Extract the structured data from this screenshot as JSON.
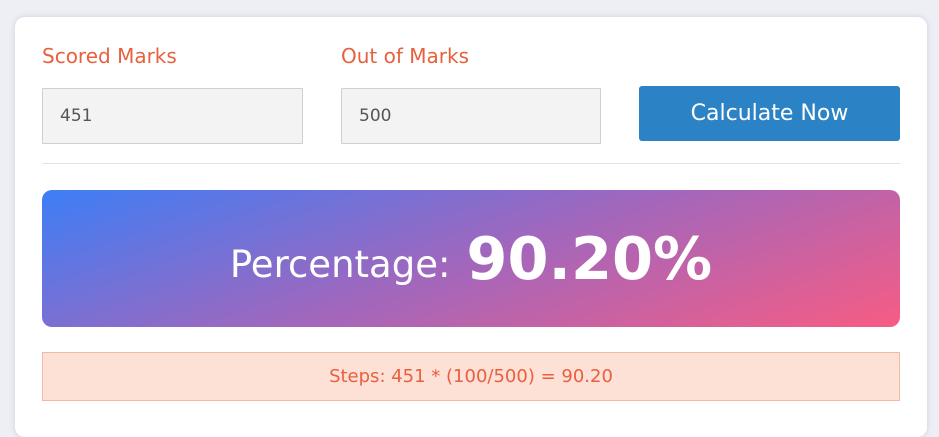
{
  "form": {
    "scored_label": "Scored Marks",
    "scored_value": "451",
    "out_of_label": "Out of Marks",
    "out_of_value": "500",
    "calculate_label": "Calculate Now"
  },
  "result": {
    "label": "Percentage:",
    "value": "90.20%"
  },
  "steps": {
    "text": "Steps: 451 * (100/500) = 90.20"
  },
  "colors": {
    "accent_text": "#e8603d",
    "button": "#2b83c5",
    "gradient_start": "#3d7ef6",
    "gradient_end": "#f75c84",
    "steps_background": "#fde0d6"
  }
}
